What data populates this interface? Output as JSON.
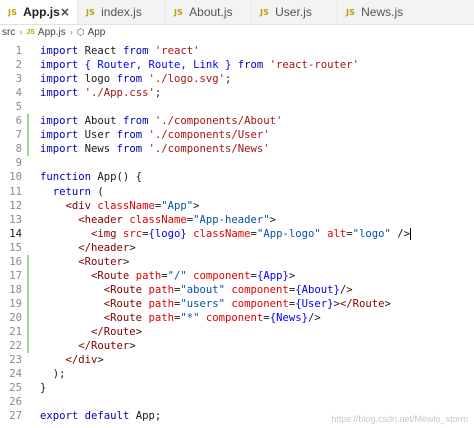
{
  "tabs": [
    {
      "label": "App.js",
      "icon": "js-file-icon",
      "active": true,
      "close": "×"
    },
    {
      "label": "index.js",
      "icon": "js-file-icon",
      "active": false
    },
    {
      "label": "About.js",
      "icon": "js-file-icon",
      "active": false
    },
    {
      "label": "User.js",
      "icon": "js-file-icon",
      "active": false
    },
    {
      "label": "News.js",
      "icon": "js-file-icon",
      "active": false
    }
  ],
  "breadcrumb": {
    "folder": "src",
    "file": "App.js",
    "symbol": "App"
  },
  "icons": {
    "js": "JS",
    "chevron": "›",
    "symbol": "⬡"
  },
  "code_lines": [
    {
      "n": "1",
      "t": "import React from 'react'"
    },
    {
      "n": "2",
      "t": "import { Router, Route, Link } from 'react-router'"
    },
    {
      "n": "3",
      "t": "import logo from './logo.svg';"
    },
    {
      "n": "4",
      "t": "import './App.css';"
    },
    {
      "n": "5",
      "t": ""
    },
    {
      "n": "6",
      "t": "import About from './components/About'"
    },
    {
      "n": "7",
      "t": "import User from './components/User'"
    },
    {
      "n": "8",
      "t": "import News from './components/News'"
    },
    {
      "n": "9",
      "t": ""
    },
    {
      "n": "10",
      "t": "function App() {"
    },
    {
      "n": "11",
      "t": "  return ("
    },
    {
      "n": "12",
      "t": "    <div className=\"App\">"
    },
    {
      "n": "13",
      "t": "      <header className=\"App-header\">"
    },
    {
      "n": "14",
      "t": "        <img src={logo} className=\"App-logo\" alt=\"logo\" />"
    },
    {
      "n": "15",
      "t": "      </header>"
    },
    {
      "n": "16",
      "t": "      <Router>"
    },
    {
      "n": "17",
      "t": "        <Route path=\"/\" component={App}>"
    },
    {
      "n": "18",
      "t": "          <Route path=\"about\" component={About}/>"
    },
    {
      "n": "19",
      "t": "          <Route path=\"users\" component={User}></Route>"
    },
    {
      "n": "20",
      "t": "          <Route path=\"*\" component={News}/>"
    },
    {
      "n": "21",
      "t": "        </Route>"
    },
    {
      "n": "22",
      "t": "      </Router>"
    },
    {
      "n": "23",
      "t": "    </div>"
    },
    {
      "n": "24",
      "t": "  );"
    },
    {
      "n": "25",
      "t": "}"
    },
    {
      "n": "26",
      "t": ""
    },
    {
      "n": "27",
      "t": "export default App;"
    }
  ],
  "current_line": "14",
  "watermark": "https://blog.csdn.net/Mewlo_storm",
  "colors": {
    "keyword": "#0000c0",
    "string": "#a31515",
    "tag": "#800000",
    "attribute": "#e50000"
  }
}
